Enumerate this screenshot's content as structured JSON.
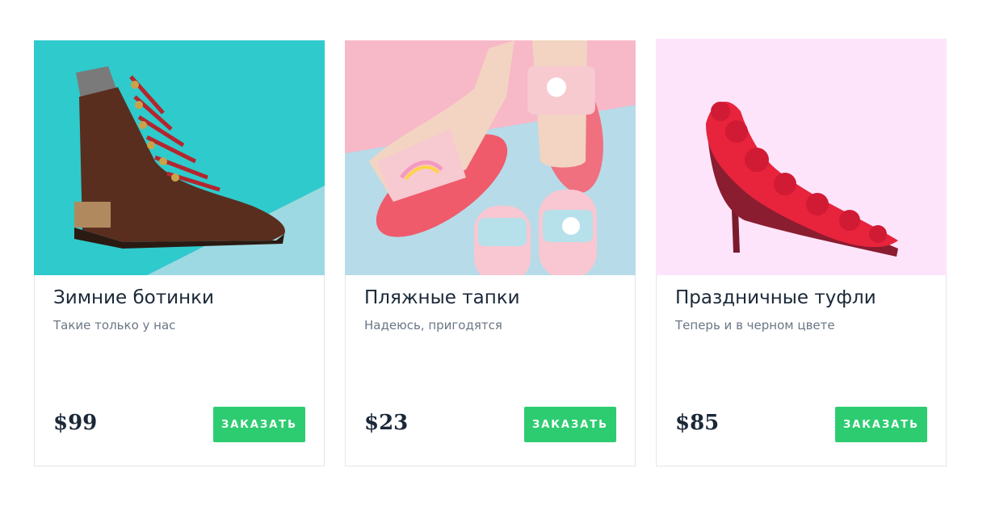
{
  "products": [
    {
      "title": "Зимние ботинки",
      "description": "Такие только у нас",
      "price": "$99",
      "button_label": "ЗАКАЗАТЬ",
      "image": "brown-boot-image"
    },
    {
      "title": "Пляжные тапки",
      "description": "Надеюсь, пригодятся",
      "price": "$23",
      "button_label": "ЗАКАЗАТЬ",
      "image": "unicorn-slides-image"
    },
    {
      "title": "Праздничные туфли",
      "description": "Теперь и в черном цвете",
      "price": "$85",
      "button_label": "ЗАКАЗАТЬ",
      "image": "red-fur-heel-image"
    }
  ],
  "colors": {
    "accent": "#2ecc71",
    "title": "#1b2838",
    "muted": "#6b7785",
    "card_border": "#e4e6ea"
  }
}
